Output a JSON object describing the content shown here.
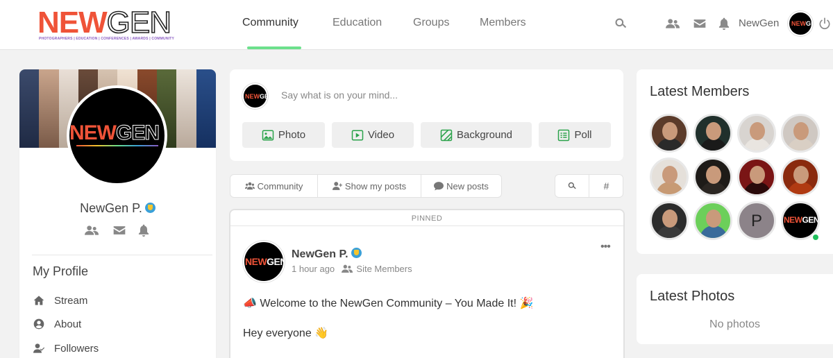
{
  "logo": {
    "part1": "NEW",
    "part2": "GEN",
    "tagline": "PHOTOGRAPHERS | EDUCATION | CONFERENCES | AWARDS | COMMUNITY"
  },
  "nav": {
    "tabs": [
      "Community",
      "Education",
      "Groups",
      "Members"
    ],
    "active": "Community"
  },
  "header": {
    "username": "NewGen",
    "icons": [
      "search-icon",
      "friends-icon",
      "messages-icon",
      "notifications-icon",
      "logout-icon"
    ]
  },
  "profile": {
    "name": "NewGen P.",
    "menu_title": "My Profile",
    "menu": [
      "Stream",
      "About",
      "Followers"
    ]
  },
  "composer": {
    "placeholder": "Say what is on your mind...",
    "buttons": [
      "Photo",
      "Video",
      "Background",
      "Poll"
    ]
  },
  "filters": {
    "items": [
      "Community",
      "Show my posts",
      "New posts"
    ],
    "hash": "#"
  },
  "post": {
    "pinned_label": "PINNED",
    "author": "NewGen P.",
    "time": "1 hour ago",
    "audience": "Site Members",
    "lines": [
      "📣 Welcome to the NewGen Community – You Made It! 🎉",
      "Hey everyone 👋"
    ]
  },
  "members": {
    "title": "Latest Members",
    "avatars": [
      {
        "bg": "#5b3b2a",
        "body": "#2a2a2a"
      },
      {
        "bg": "#20302c",
        "body": "#1a1a1a"
      },
      {
        "bg": "#d8d4d0",
        "body": "#e9e5e0"
      },
      {
        "bg": "#cfc8c2",
        "body": "#d9cfc4"
      },
      {
        "bg": "#e5e0da",
        "body": "#c79a74"
      },
      {
        "bg": "#1e1b18",
        "body": "#2b2622"
      },
      {
        "bg": "#7a1515",
        "body": "#2a0a0a"
      },
      {
        "bg": "#8a2a0e",
        "body": "#b03a12"
      },
      {
        "bg": "#2c2c2c",
        "body": "#3a3a3a"
      },
      {
        "bg": "#6ccf5a",
        "body": "#3a6b9a"
      },
      {
        "bg": "#8c8389",
        "body": "",
        "letter": "P"
      },
      {
        "bg": "#000000",
        "body": "",
        "logo": true
      }
    ]
  },
  "photos": {
    "title": "Latest Photos",
    "empty": "No photos"
  },
  "colors": {
    "accent": "#6ce08c",
    "brand_red": "#ef5338",
    "online": "#20c05c"
  }
}
